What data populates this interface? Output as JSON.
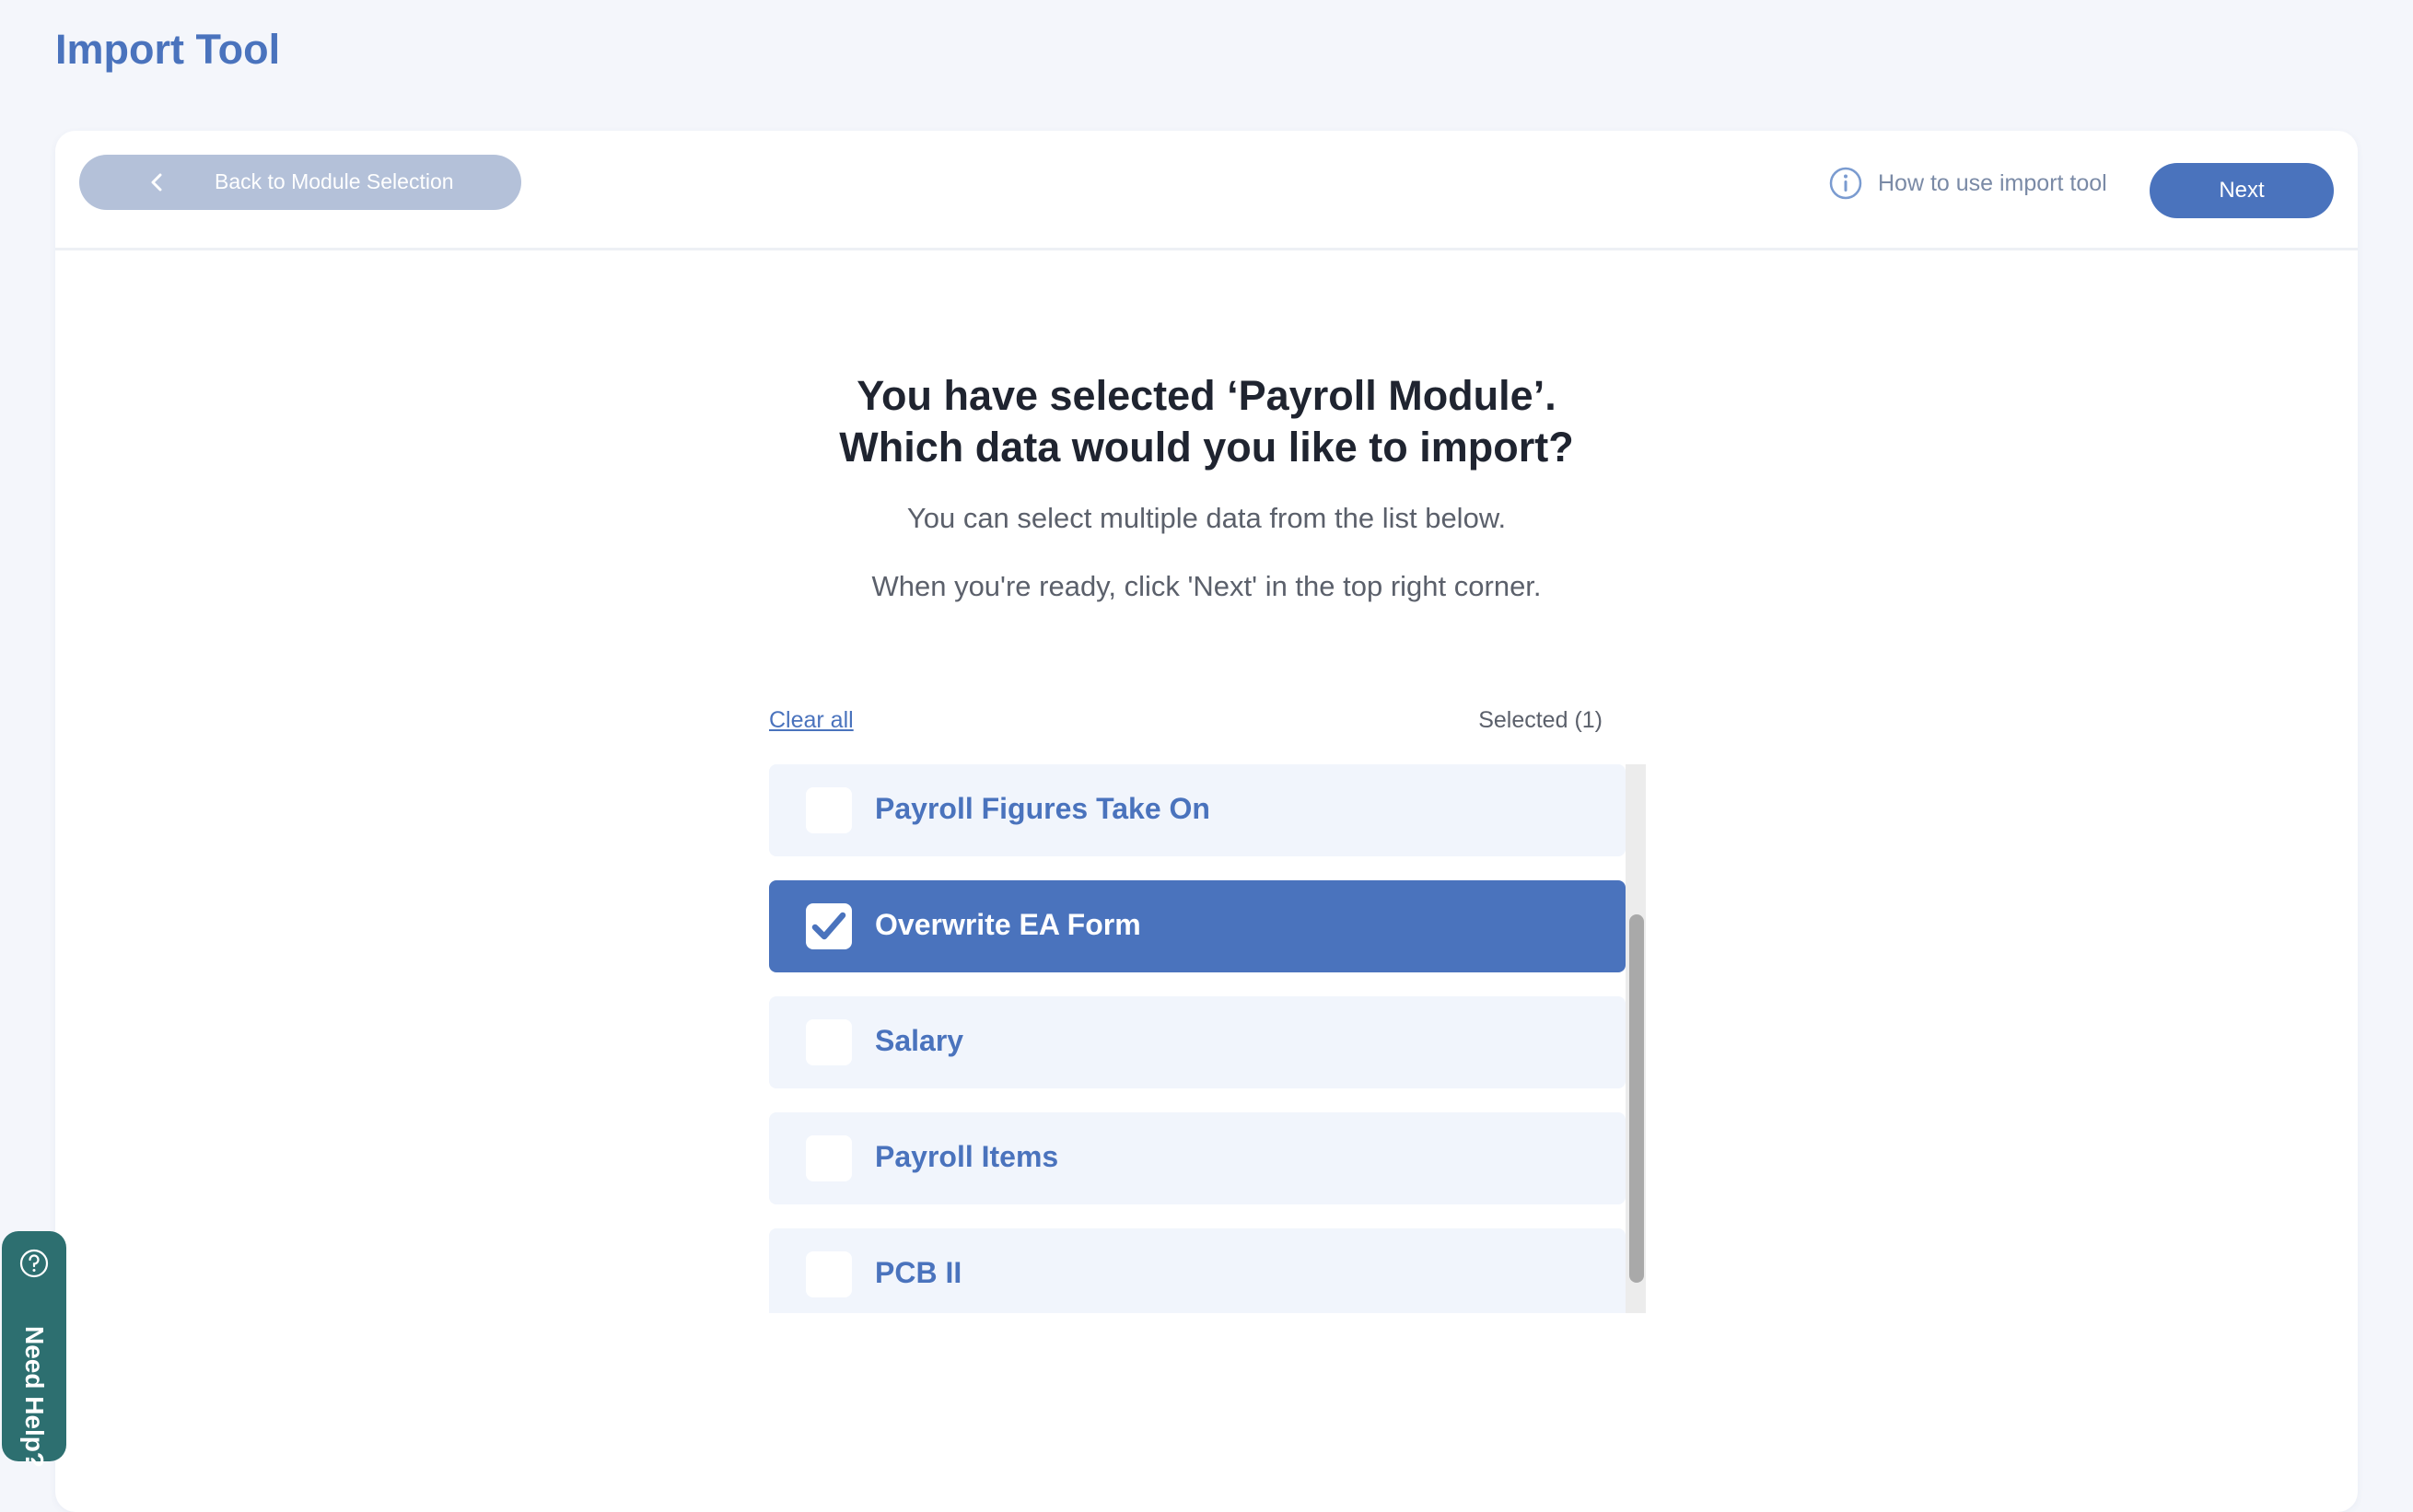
{
  "page": {
    "title": "Import Tool"
  },
  "toolbar": {
    "back_label": "Back to Module Selection",
    "howto_label": "How to use import tool",
    "next_label": "Next"
  },
  "main": {
    "heading_line1": "You have selected ‘Payroll Module’.",
    "heading_line2": "Which data would you like to import?",
    "sub1": "You can select multiple data from the list below.",
    "sub2": "When you're ready, click 'Next' in the top right corner.",
    "clear_all": "Clear all",
    "selected_count": "Selected (1)",
    "items": [
      {
        "label": "Payroll Figures Take On",
        "checked": false
      },
      {
        "label": "Overwrite EA Form",
        "checked": true
      },
      {
        "label": "Salary",
        "checked": false
      },
      {
        "label": "Payroll Items",
        "checked": false
      },
      {
        "label": "PCB II",
        "checked": false
      }
    ]
  },
  "help": {
    "label": "Need Help?"
  },
  "colors": {
    "accent": "#4a73bd",
    "back_button": "#b4c1d9",
    "item_bg": "#f1f5fc",
    "help_bg": "#2d6f70",
    "page_bg": "#f4f6fb"
  },
  "icons": {
    "back": "chevron-left-icon",
    "info": "info-icon",
    "check": "checkmark-icon",
    "help": "question-circle-icon"
  }
}
